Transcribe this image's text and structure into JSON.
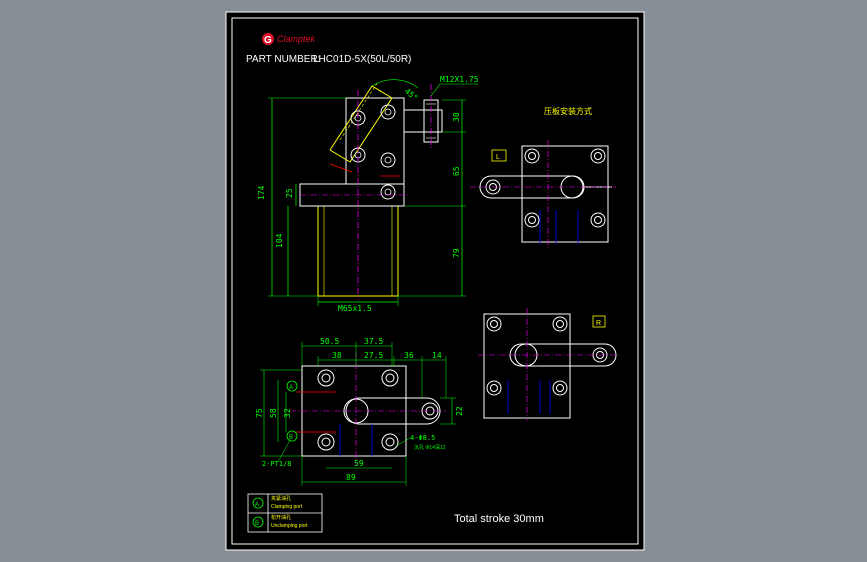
{
  "brand": {
    "name": "Clamptek",
    "mark": "G"
  },
  "header": {
    "part_number_label": "PART NUMBER:",
    "part_number_value": "LHC01D-5X(50L/50R)"
  },
  "front_view": {
    "thread_top": "M12X1.75",
    "angle": "45°",
    "dims": {
      "overall_height": "174",
      "body_height": "104",
      "arm_offset": "25",
      "top": "30",
      "mid": "65",
      "lower": "79",
      "thread_bottom": "M65x1.5"
    }
  },
  "plan_view": {
    "dims_top": [
      "50.5",
      "37.5"
    ],
    "dims_row2": [
      "38",
      "27.5",
      "36",
      "14"
    ],
    "dims_left": [
      "75",
      "58",
      "32"
    ],
    "dim_right": "22",
    "dims_bottom": [
      "59",
      "89"
    ],
    "port_callout": "2-PT1/8",
    "hole_callout": "4-Φ8.5",
    "hole_note": "沉孔 Φ14深12",
    "port_markers": [
      "A",
      "B"
    ]
  },
  "mounting": {
    "title": "压板安装方式",
    "left_tag": "L",
    "right_tag": "R"
  },
  "legend": {
    "rows": [
      {
        "marker": "A",
        "cn": "夹紧油孔",
        "en": "Clamping port"
      },
      {
        "marker": "B",
        "cn": "松开油孔",
        "en": "Unclamping port"
      }
    ]
  },
  "footer": {
    "stroke_note": "Total stroke 30mm"
  },
  "colors": {
    "background": "#000000",
    "frame": "#ffffff",
    "dim": "#00ff00",
    "part": "#ffffff",
    "center": "#ff00ff",
    "annotation": "#ffff00",
    "accent": "#ff0000",
    "hidden": "#0000ff"
  }
}
